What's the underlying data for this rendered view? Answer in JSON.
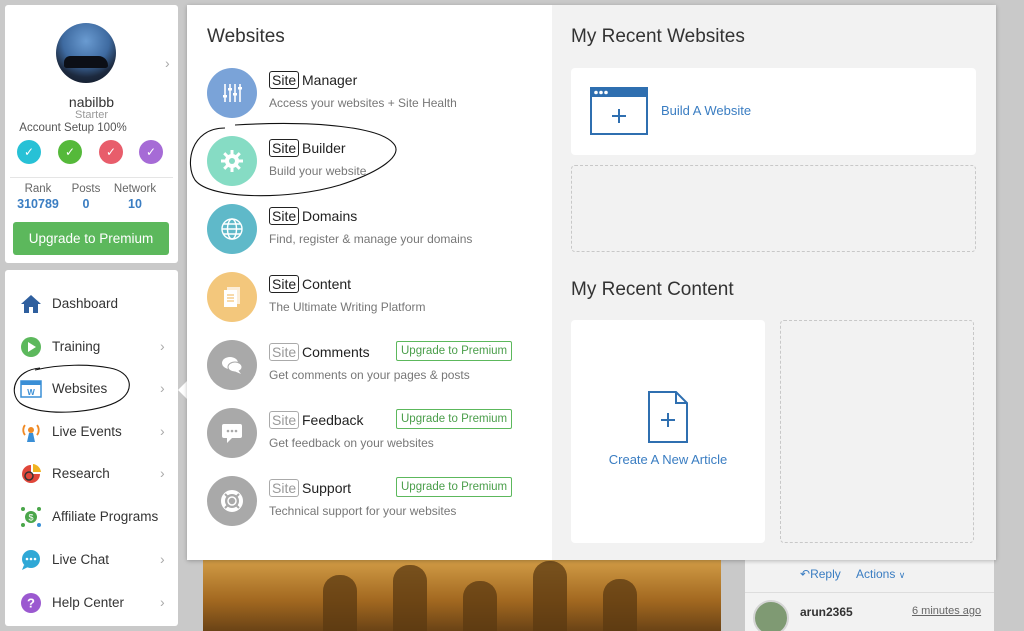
{
  "profile": {
    "username": "nabilbb",
    "plan": "Starter",
    "setup_text": "Account Setup 100%",
    "steps": [
      {
        "color": "#27c1d6"
      },
      {
        "color": "#55b93a"
      },
      {
        "color": "#e85d6b"
      },
      {
        "color": "#a66bd6"
      }
    ],
    "stats": [
      {
        "label": "Rank",
        "value": "310789"
      },
      {
        "label": "Posts",
        "value": "0"
      },
      {
        "label": "Network",
        "value": "10"
      }
    ],
    "upgrade_label": "Upgrade to Premium"
  },
  "nav": {
    "items": [
      {
        "label": "Dashboard",
        "icon": "home-icon"
      },
      {
        "label": "Training",
        "icon": "play-icon"
      },
      {
        "label": "Websites",
        "icon": "website-icon"
      },
      {
        "label": "Live Events",
        "icon": "broadcast-icon"
      },
      {
        "label": "Research",
        "icon": "research-icon"
      },
      {
        "label": "Affiliate Programs",
        "icon": "dollar-network-icon"
      },
      {
        "label": "Live Chat",
        "icon": "chat-icon"
      },
      {
        "label": "Help Center",
        "icon": "question-icon"
      }
    ]
  },
  "websites_menu": {
    "title": "Websites",
    "badge": "Site",
    "premium_label": "Upgrade to Premium",
    "items": [
      {
        "name": "Manager",
        "desc": "Access your websites + Site Health",
        "icon": "sliders-icon",
        "color": "#7aa3d8",
        "premium": false
      },
      {
        "name": "Builder",
        "desc": "Build your website",
        "icon": "gear-icon",
        "color": "#86dcc4",
        "premium": false
      },
      {
        "name": "Domains",
        "desc": "Find, register & manage your domains",
        "icon": "globe-icon",
        "color": "#5fb9c9",
        "premium": false
      },
      {
        "name": "Content",
        "desc": "The Ultimate Writing Platform",
        "icon": "document-icon",
        "color": "#f3c77c",
        "premium": false
      },
      {
        "name": "Comments",
        "desc": "Get comments on your pages & posts",
        "icon": "comments-icon",
        "color": "#a9a9a9",
        "premium": true
      },
      {
        "name": "Feedback",
        "desc": "Get feedback on your websites",
        "icon": "feedback-icon",
        "color": "#a9a9a9",
        "premium": true
      },
      {
        "name": "Support",
        "desc": "Technical support for your websites",
        "icon": "lifebuoy-icon",
        "color": "#a9a9a9",
        "premium": true
      }
    ]
  },
  "recent_websites": {
    "title": "My Recent Websites",
    "build_label": "Build A Website"
  },
  "recent_content": {
    "title": "My Recent Content",
    "create_label": "Create A New Article"
  },
  "background": {
    "reply": "Reply",
    "actions": "Actions",
    "comment_user": "arun2365",
    "comment_time": "6 minutes ago"
  },
  "colors": {
    "accent_blue": "#3a7dc2",
    "premium_green": "#5cb85c"
  }
}
